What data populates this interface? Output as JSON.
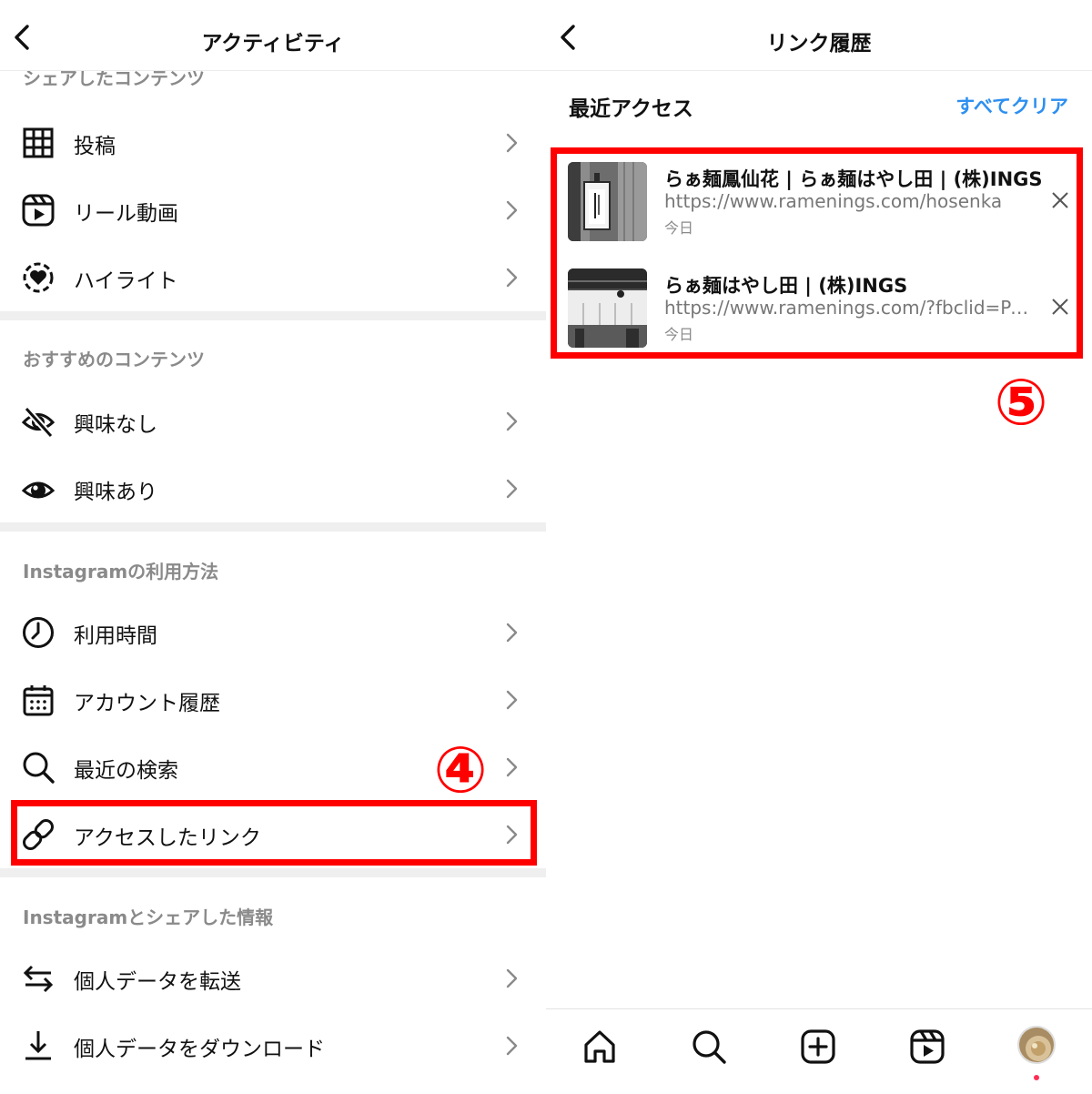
{
  "left": {
    "title": "アクティビティ",
    "partial_section": "シェアしたコンテンツ",
    "items_shared": [
      {
        "label": "投稿",
        "icon": "grid-icon"
      },
      {
        "label": "リール動画",
        "icon": "reels-icon"
      },
      {
        "label": "ハイライト",
        "icon": "highlight-icon"
      }
    ],
    "section_recommended": "おすすめのコンテンツ",
    "items_recommended": [
      {
        "label": "興味なし",
        "icon": "eye-off-icon"
      },
      {
        "label": "興味あり",
        "icon": "eye-icon"
      }
    ],
    "section_usage": "Instagramの利用方法",
    "items_usage": [
      {
        "label": "利用時間",
        "icon": "clock-icon"
      },
      {
        "label": "アカウント履歴",
        "icon": "calendar-icon"
      },
      {
        "label": "最近の検索",
        "icon": "search-icon"
      },
      {
        "label": "アクセスしたリンク",
        "icon": "link-icon"
      }
    ],
    "section_info": "Instagramとシェアした情報",
    "items_info": [
      {
        "label": "個人データを転送",
        "icon": "transfer-icon"
      },
      {
        "label": "個人データをダウンロード",
        "icon": "download-icon"
      }
    ],
    "annotation": "④"
  },
  "right": {
    "title": "リンク履歴",
    "recent_label": "最近アクセス",
    "clear_all": "すべてクリア",
    "links": [
      {
        "title": "らぁ麺鳳仙花 | らぁ麺はやし田 | (株)INGS",
        "url": "https://www.ramenings.com/hosenka",
        "date": "今日"
      },
      {
        "title": "らぁ麺はやし田 | (株)INGS",
        "url": "https://www.ramenings.com/?fbclid=PA...",
        "date": "今日"
      }
    ],
    "annotation": "⑤",
    "tabs": [
      "home-icon",
      "search-icon",
      "create-icon",
      "reels-icon",
      "profile-avatar"
    ]
  },
  "colors": {
    "highlight": "#ff0000",
    "link_blue": "#2d8ff0",
    "notification_dot": "#ff2d55"
  }
}
